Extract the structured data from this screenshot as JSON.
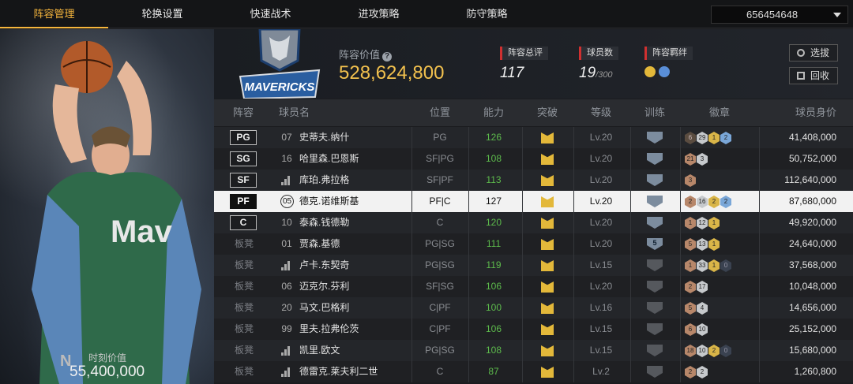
{
  "tabs": [
    "阵容管理",
    "轮换设置",
    "快速战术",
    "进攻策略",
    "防守策略"
  ],
  "account": {
    "id": "656454648"
  },
  "player_panel": {
    "market_value_label": "时刻价值",
    "market_value": "55,400,000"
  },
  "team": {
    "lineup_value_label": "阵容价值",
    "lineup_value": "528,624,800",
    "rating_label": "阵容总评",
    "rating": "117",
    "player_count_label": "球员数",
    "player_count": "19",
    "player_count_max": "/300",
    "bond_label": "阵容羁绊",
    "select_button": "选拔",
    "recycle_button": "回收"
  },
  "columns": [
    "阵容",
    "球员名",
    "位置",
    "能力",
    "突破",
    "等级",
    "训练",
    "徽章",
    "球员身价"
  ],
  "rows": [
    {
      "slot": "PG",
      "starter": true,
      "num": "07",
      "name": "史蒂夫.纳什",
      "pos": "PG",
      "ability": "126",
      "lv": "Lv.20",
      "train": "",
      "badges": [
        [
          "e",
          "6"
        ],
        [
          "s",
          "29"
        ],
        [
          "g",
          "1"
        ],
        [
          "h",
          "2"
        ]
      ],
      "value": "41,408,000"
    },
    {
      "slot": "SG",
      "starter": true,
      "num": "16",
      "name": "哈里森.巴恩斯",
      "pos": "SF|PG",
      "ability": "108",
      "lv": "Lv.20",
      "train": "",
      "badges": [
        [
          "b",
          "21"
        ],
        [
          "s",
          "3"
        ]
      ],
      "value": "50,752,000"
    },
    {
      "slot": "SF",
      "starter": true,
      "num": "bars",
      "name": "库珀.弗拉格",
      "pos": "SF|PF",
      "ability": "113",
      "lv": "Lv.20",
      "train": "",
      "badges": [
        [
          "b",
          "3"
        ]
      ],
      "value": "112,640,000"
    },
    {
      "slot": "PF",
      "starter": true,
      "num": "05",
      "name": "德克.诺维斯基",
      "pos": "PF|C",
      "ability": "127",
      "lv": "Lv.20",
      "train": "",
      "badges": [
        [
          "b",
          "2"
        ],
        [
          "s",
          "16"
        ],
        [
          "g",
          "2"
        ],
        [
          "h",
          "2"
        ]
      ],
      "value": "87,680,000",
      "selected": true
    },
    {
      "slot": "C",
      "starter": true,
      "num": "10",
      "name": "泰森.钱德勒",
      "pos": "C",
      "ability": "120",
      "lv": "Lv.20",
      "train": "",
      "badges": [
        [
          "b",
          "1"
        ],
        [
          "s",
          "12"
        ],
        [
          "g",
          "1"
        ]
      ],
      "value": "49,920,000"
    },
    {
      "slot": "板凳",
      "starter": false,
      "num": "01",
      "name": "贾森.基德",
      "pos": "PG|SG",
      "ability": "111",
      "lv": "Lv.20",
      "train": "5",
      "badges": [
        [
          "b",
          "5"
        ],
        [
          "s",
          "13"
        ],
        [
          "g",
          "1"
        ]
      ],
      "value": "24,640,000"
    },
    {
      "slot": "板凳",
      "starter": false,
      "num": "bars",
      "name": "卢卡.东契奇",
      "pos": "PG|SG",
      "ability": "119",
      "lv": "Lv.15",
      "train": "dim",
      "badges": [
        [
          "b",
          "1"
        ],
        [
          "s",
          "33"
        ],
        [
          "g",
          "1"
        ],
        [
          "x",
          "0"
        ]
      ],
      "value": "37,568,000"
    },
    {
      "slot": "板凳",
      "starter": false,
      "num": "06",
      "name": "迈克尔.芬利",
      "pos": "SF|SG",
      "ability": "106",
      "lv": "Lv.20",
      "train": "dim",
      "badges": [
        [
          "b",
          "2"
        ],
        [
          "s",
          "17"
        ]
      ],
      "value": "10,048,000"
    },
    {
      "slot": "板凳",
      "starter": false,
      "num": "20",
      "name": "马文.巴格利",
      "pos": "C|PF",
      "ability": "100",
      "lv": "Lv.16",
      "train": "dim",
      "badges": [
        [
          "b",
          "5"
        ],
        [
          "s",
          "4"
        ]
      ],
      "value": "14,656,000"
    },
    {
      "slot": "板凳",
      "starter": false,
      "num": "99",
      "name": "里夫.拉弗伦茨",
      "pos": "C|PF",
      "ability": "106",
      "lv": "Lv.15",
      "train": "dim",
      "badges": [
        [
          "b",
          "6"
        ],
        [
          "s",
          "10"
        ]
      ],
      "value": "25,152,000"
    },
    {
      "slot": "板凳",
      "starter": false,
      "num": "bars",
      "name": "凯里.欧文",
      "pos": "PG|SG",
      "ability": "108",
      "lv": "Lv.15",
      "train": "dim",
      "badges": [
        [
          "b",
          "18"
        ],
        [
          "s",
          "10"
        ],
        [
          "g",
          "2"
        ],
        [
          "x",
          "0"
        ]
      ],
      "value": "15,680,000"
    },
    {
      "slot": "板凳",
      "starter": false,
      "num": "bars",
      "name": "德雷克.莱夫利二世",
      "pos": "C",
      "ability": "87",
      "lv": "Lv.2",
      "train": "dim",
      "badges": [
        [
          "b",
          "2"
        ],
        [
          "s",
          "2"
        ]
      ],
      "value": "1,260,800"
    }
  ]
}
